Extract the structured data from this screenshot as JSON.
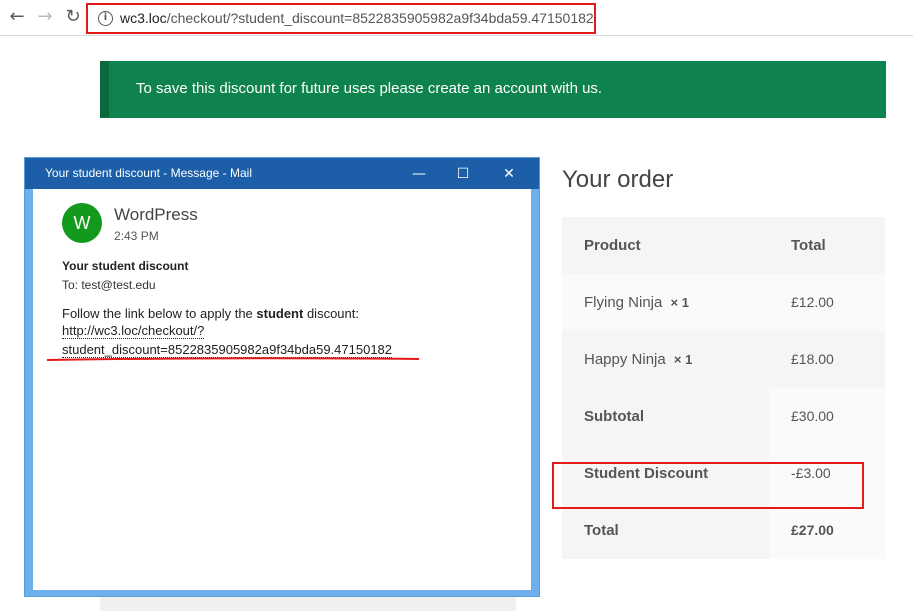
{
  "browser": {
    "back_icon": "arrow-left-icon",
    "forward_icon": "arrow-right-icon",
    "reload_icon": "reload-icon",
    "info_icon": "info-icon",
    "url_host": "wc3.loc",
    "url_path": "/checkout/?student_discount=8522835905982a9f34bda59.47150182"
  },
  "notice": {
    "text": "To save this discount for future uses please create an account with us.",
    "color": "#0f834d"
  },
  "order": {
    "title": "Your order",
    "columns": [
      "Product",
      "Total"
    ],
    "items": [
      {
        "name": "Flying Ninja",
        "qty": "× 1",
        "total": "£12.00"
      },
      {
        "name": "Happy Ninja",
        "qty": "× 1",
        "total": "£18.00"
      }
    ],
    "subtotal_label": "Subtotal",
    "subtotal_value": "£30.00",
    "discount_label": "Student Discount",
    "discount_value": "-£3.00",
    "total_label": "Total",
    "total_value": "£27.00"
  },
  "mail": {
    "window_title": "Your student discount - Message - Mail",
    "minimize_icon": "minimize-icon",
    "maximize_icon": "maximize-icon",
    "close_icon": "close-icon",
    "avatar_letter": "W",
    "sender": "WordPress",
    "time": "2:43 PM",
    "subject": "Your student discount",
    "to": "To: test@test.edu",
    "body_prefix": "Follow the link below to apply the ",
    "body_bold": "student",
    "body_suffix": " discount:",
    "link_line1": "http://wc3.loc/checkout/?",
    "link_line2": "student_discount=8522835905982a9f34bda59.47150182"
  },
  "highlight_color": "#e11a1a"
}
